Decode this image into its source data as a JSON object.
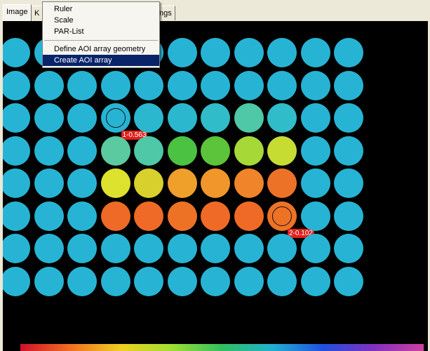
{
  "tabs": [
    {
      "label": "Image"
    },
    {
      "label": "K"
    },
    {
      "label": "ngs"
    }
  ],
  "menu": {
    "items": [
      {
        "label": "Ruler"
      },
      {
        "label": "Scale"
      },
      {
        "label": "PAR-List"
      },
      {
        "label": "Define AOI array geometry"
      },
      {
        "label": "Create AOI array",
        "selected": true
      }
    ]
  },
  "plate": {
    "rows": [
      [
        "#27b4d4",
        "#27b4d4",
        "#27b4d4",
        "#27b4d4",
        "#27b4d4",
        "#27b4d4",
        "#27b4d4",
        "#27b4d4",
        "#27b4d4",
        "#27b4d4",
        "#27b4d4"
      ],
      [
        "#27b4d4",
        "#27b4d4",
        "#27b4d4",
        "#27b4d4",
        "#27b4d4",
        "#27b4d4",
        "#27b4d4",
        "#27b4d4",
        "#27b4d4",
        "#27b4d4",
        "#27b4d4"
      ],
      [
        "#27b4d4",
        "#27b4d4",
        "#27b4d4",
        "#27b4d4",
        "#2bb8cf",
        "#2bb8cf",
        "#30bcc8",
        "#4ec8a6",
        "#30bcc8",
        "#27b4d4",
        "#27b4d4"
      ],
      [
        "#27b4d4",
        "#27b4d4",
        "#27b4d4",
        "#5ccaa0",
        "#4ec8a6",
        "#4cc242",
        "#5cc43a",
        "#a6d838",
        "#c6dc32",
        "#27b4d4",
        "#27b4d4"
      ],
      [
        "#27b4d4",
        "#27b4d4",
        "#27b4d4",
        "#dce22e",
        "#d8d02c",
        "#eea02a",
        "#f0962a",
        "#f0842a",
        "#ec7228",
        "#27b4d4",
        "#27b4d4"
      ],
      [
        "#27b4d4",
        "#27b4d4",
        "#27b4d4",
        "#ee6a26",
        "#ee6a26",
        "#ee7226",
        "#ee6a26",
        "#ee6a26",
        "#ee7226",
        "#27b4d4",
        "#27b4d4"
      ],
      [
        "#27b4d4",
        "#27b4d4",
        "#27b4d4",
        "#27b4d4",
        "#27b4d4",
        "#27b4d4",
        "#27b4d4",
        "#27b4d4",
        "#27b4d4",
        "#27b4d4",
        "#27b4d4"
      ],
      [
        "#27b4d4",
        "#27b4d4",
        "#27b4d4",
        "#27b4d4",
        "#27b4d4",
        "#27b4d4",
        "#27b4d4",
        "#27b4d4",
        "#27b4d4",
        "#27b4d4",
        "#27b4d4"
      ]
    ],
    "labels": [
      {
        "text": "1-0.563",
        "row": 2,
        "col": 3
      },
      {
        "text": "2-0.102",
        "row": 5,
        "col": 8
      }
    ]
  },
  "colors": {
    "background": "#000000",
    "menu_selected": "#0a246a",
    "aoi_label": "#e0201c"
  }
}
